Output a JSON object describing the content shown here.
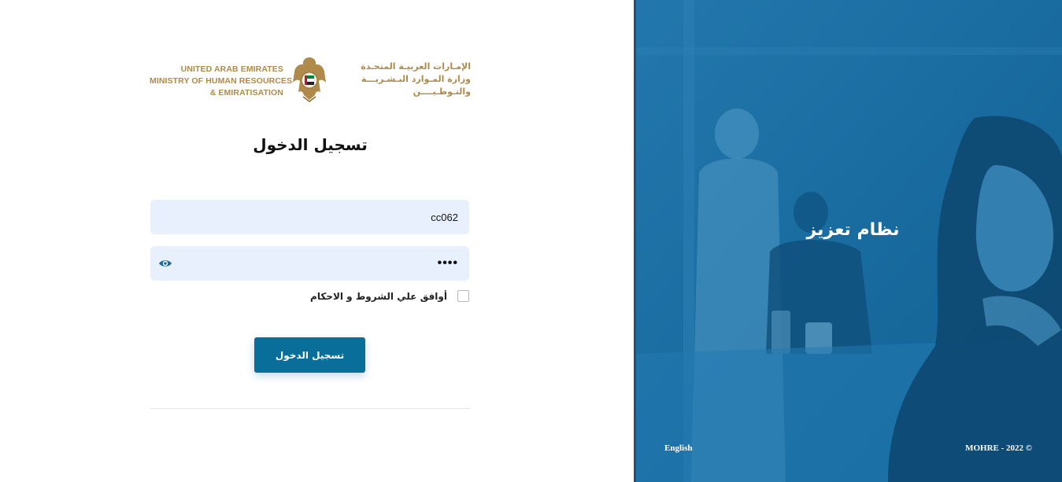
{
  "logo": {
    "en_lines": [
      "UNITED ARAB EMIRATES",
      "MINISTRY OF HUMAN RESOURCES",
      "& EMIRATISATION"
    ],
    "ar_lines": [
      "الإمـارات العربيـة المتحـدة",
      "وزارة المـوارد البـشـريـــة",
      "والتـوطـيــــن"
    ]
  },
  "login": {
    "title": "تسجيل الدخول",
    "username_value": "cc062",
    "password_value": "••••",
    "agree_label": "أوافق علي الشروط و الاحكام",
    "submit_label": "تسجيل الدخول"
  },
  "side_panel": {
    "system_name": "نظام تعزيز",
    "language_link": "English",
    "copyright": "MOHRE - 2022 ©"
  },
  "colors": {
    "accent": "#0a6e9b",
    "gold": "#b08a4a",
    "input_bg": "#e8f0fe"
  }
}
